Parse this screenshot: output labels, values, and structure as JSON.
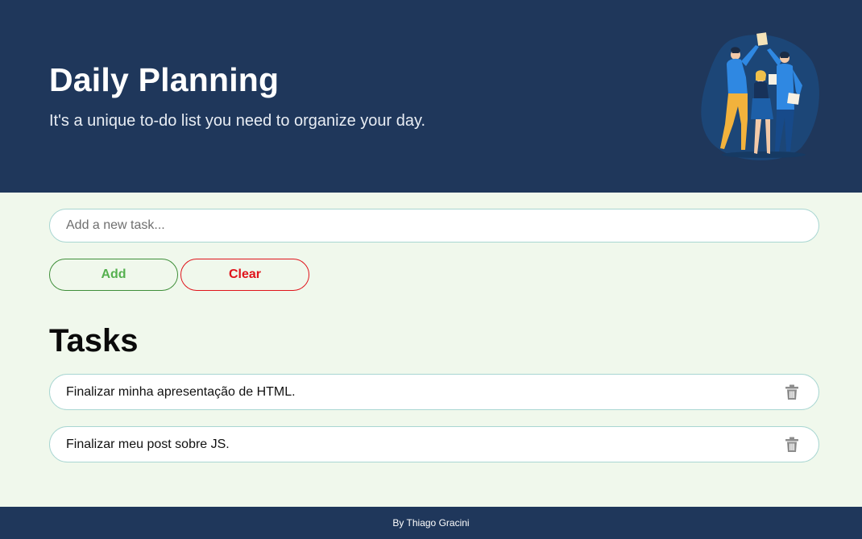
{
  "header": {
    "title": "Daily Planning",
    "subtitle": "It's a unique to-do list you need to organize your day.",
    "illustration_icon": "team-collaboration-illustration"
  },
  "form": {
    "input_placeholder": "Add a new task...",
    "input_value": "",
    "add_label": "Add",
    "clear_label": "Clear"
  },
  "tasks": {
    "heading": "Tasks",
    "items": [
      {
        "text": "Finalizar minha apresentação de HTML.",
        "icon": "trash-icon"
      },
      {
        "text": "Finalizar meu post sobre JS.",
        "icon": "trash-icon"
      }
    ]
  },
  "footer": {
    "credit": "By Thiago Gracini"
  },
  "colors": {
    "header_bg": "#1f375b",
    "page_bg": "#f0f8ec",
    "add_accent": "#55b04f",
    "clear_accent": "#e0141b",
    "border": "#a9d6d2"
  }
}
